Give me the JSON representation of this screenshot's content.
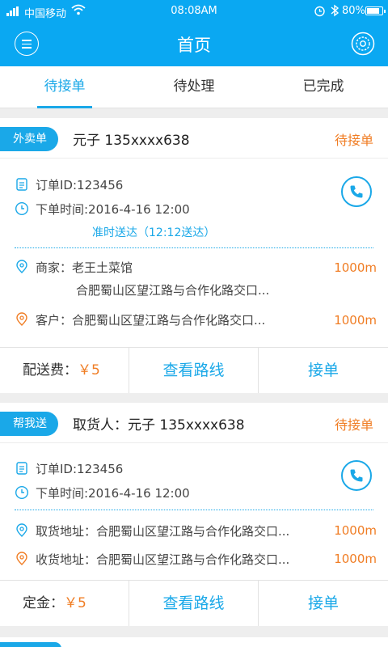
{
  "status_bar": {
    "carrier": "中国移动",
    "time": "08:08AM",
    "battery": "80%",
    "icons": [
      "signal-icon",
      "wifi-icon",
      "alarm-icon",
      "bluetooth-icon",
      "battery-icon"
    ]
  },
  "app_bar": {
    "title": "首页",
    "left_icon": "menu-icon",
    "right_icon": "settings-icon"
  },
  "tabs": [
    {
      "label": "待接单",
      "active": true
    },
    {
      "label": "待处理",
      "active": false
    },
    {
      "label": "已完成",
      "active": false
    }
  ],
  "orders": [
    {
      "type_badge": "外卖单",
      "header": "元子  135xxxx638",
      "status": "待接单",
      "order_id": "订单ID:123456",
      "order_time": "下单时间:2016-4-16 12:00",
      "delivery_note": "准时送达（12:12送达）",
      "merchant_label": "商家：老王土菜馆",
      "merchant_address": "合肥蜀山区望江路与合作化路交口...",
      "merchant_distance": "1000m",
      "customer_label": "客户：合肥蜀山区望江路与合作化路交口...",
      "customer_distance": "1000m",
      "fee_label": "配送费：",
      "fee_amount": "￥5",
      "route_button": "查看路线",
      "accept_button": "接单"
    },
    {
      "type_badge": "帮我送",
      "header": "取货人：元子  135xxxx638",
      "status": "待接单",
      "order_id": "订单ID:123456",
      "order_time": "下单时间:2016-4-16 12:00",
      "pickup_label": "取货地址：合肥蜀山区望江路与合作化路交口...",
      "pickup_distance": "1000m",
      "dropoff_label": "收货地址：合肥蜀山区望江路与合作化路交口...",
      "dropoff_distance": "1000m",
      "fee_label": "定金：",
      "fee_amount": "￥5",
      "route_button": "查看路线",
      "accept_button": "接单"
    }
  ],
  "colors": {
    "primary": "#0aa8f2",
    "accent_blue": "#1aa8e8",
    "accent_orange": "#f07d24",
    "background": "#eeeeee"
  }
}
